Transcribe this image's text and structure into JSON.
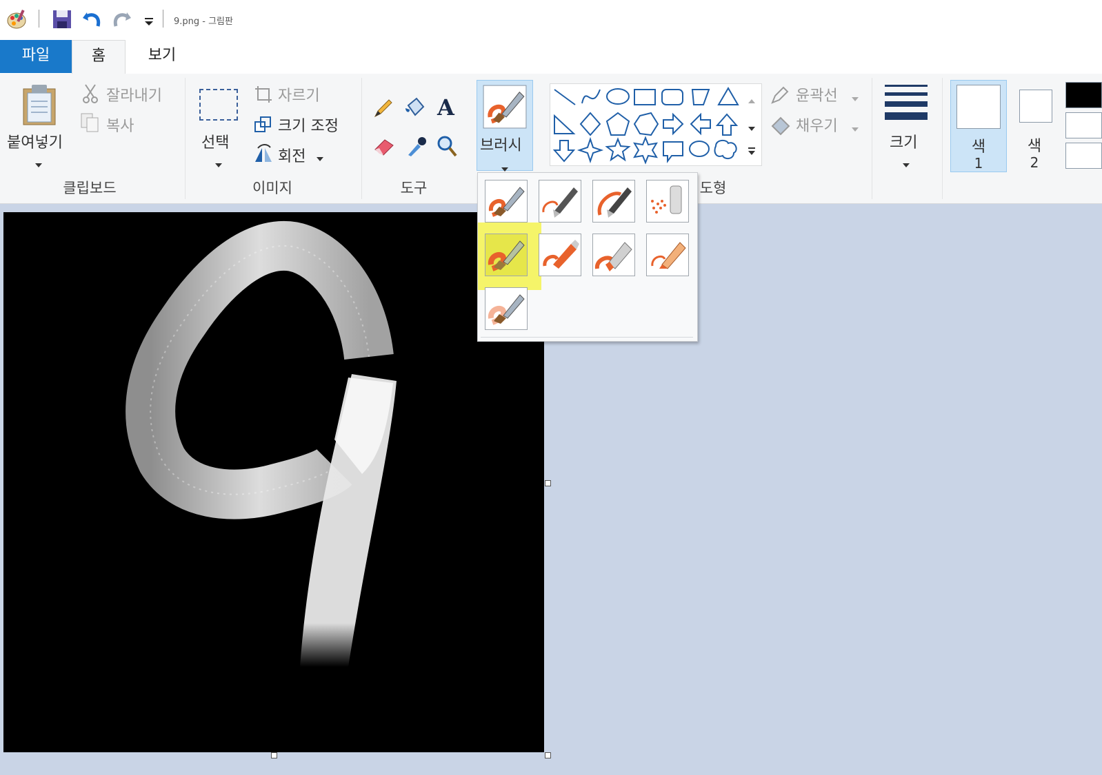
{
  "window": {
    "title": "9.png - 그림판"
  },
  "tabs": {
    "file": "파일",
    "home": "홈",
    "view": "보기"
  },
  "clipboard": {
    "paste": "붙여넣기",
    "cut": "잘라내기",
    "copy": "복사",
    "group": "클립보드"
  },
  "image": {
    "select": "선택",
    "crop": "자르기",
    "resize": "크기 조정",
    "rotate": "회전",
    "group": "이미지"
  },
  "tools": {
    "group": "도구"
  },
  "brushes": {
    "label": "브러시"
  },
  "shapes": {
    "outline": "윤곽선",
    "fill": "채우기",
    "group_partial": "도형"
  },
  "size": {
    "label": "크기"
  },
  "colors": {
    "color1_line1": "색",
    "color1_line2": "1",
    "color2_line1": "색",
    "color2_line2": "2",
    "color1": "#ffffff",
    "color2": "#ffffff",
    "black": "#000000"
  },
  "accent": {
    "file_tab": "#1979ca",
    "selected_highlight": "#f4f34f",
    "brush_orange": "#e8622c",
    "workspace": "#c9d4e6"
  }
}
